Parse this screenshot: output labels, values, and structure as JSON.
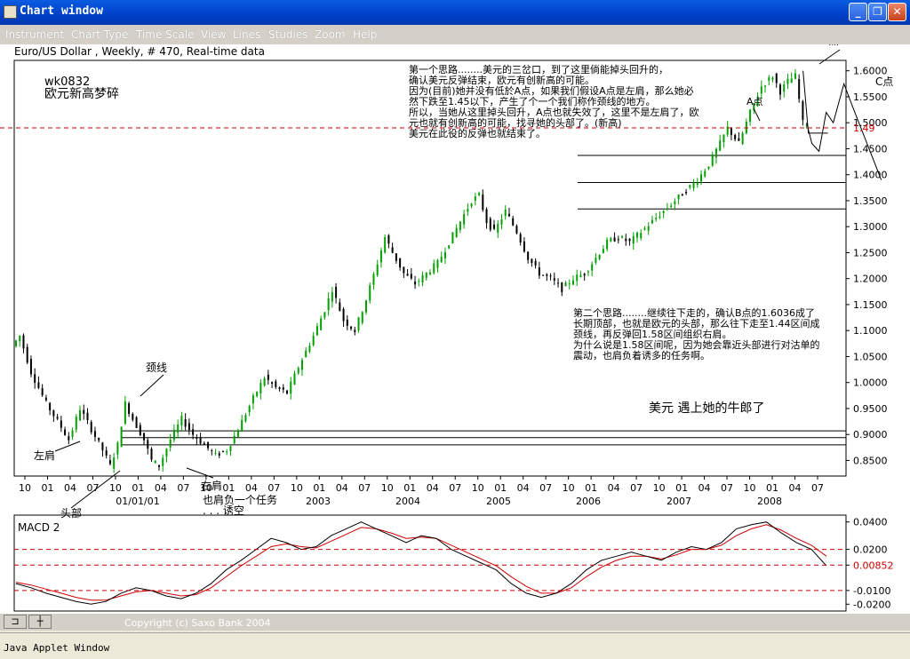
{
  "window": {
    "title": "Chart window",
    "buttons": [
      "_",
      "❐",
      "✕"
    ]
  },
  "menu": [
    "Instrument",
    "Chart Type",
    "Time Scale",
    "View",
    "Lines",
    "Studies",
    "Zoom",
    "Help"
  ],
  "chart_header": "Euro/US Dollar , Weekly, # 470, Real-time data",
  "colors": {
    "up": "#00a000",
    "down": "#000000",
    "dashed": "#cc0000",
    "macd": "#000000",
    "signal": "#cc0000"
  },
  "chart_data": [
    {
      "type": "candlestick",
      "title": "wk0832",
      "subtitle": "欧元新高梦碎",
      "ylim": [
        0.82,
        1.62
      ],
      "y_ticks": [
        "1.6000",
        "1.5500",
        "1.5000",
        "1.4500",
        "1.4000",
        "1.3500",
        "1.3000",
        "1.2500",
        "1.2000",
        "1.1500",
        "1.1000",
        "1.0500",
        "1.0000",
        "0.9500",
        "0.9000",
        "0.8500"
      ],
      "y_tick_values": [
        1.6,
        1.55,
        1.5,
        1.45,
        1.4,
        1.35,
        1.3,
        1.25,
        1.2,
        1.15,
        1.1,
        1.05,
        1.0,
        0.95,
        0.9,
        0.85
      ],
      "x_ticks": [
        "10",
        "01",
        "04",
        "07",
        "10",
        "01",
        "04",
        "07",
        "10",
        "01",
        "04",
        "07",
        "10",
        "01",
        "04",
        "07",
        "10",
        "01",
        "04",
        "07",
        "10",
        "01",
        "04",
        "07",
        "10",
        "01",
        "04",
        "07",
        "10",
        "01",
        "04",
        "07",
        "10",
        "01",
        "04",
        "07"
      ],
      "x_year_labels": [
        "01/01/01",
        "2003",
        "2004",
        "2005",
        "2006",
        "2007",
        "2008"
      ],
      "current_price_label": "1.49",
      "current_price": 1.49,
      "trend_points": [
        [
          0,
          1.07
        ],
        [
          4,
          1.09
        ],
        [
          10,
          1.02
        ],
        [
          18,
          0.96
        ],
        [
          25,
          0.92
        ],
        [
          30,
          0.89
        ],
        [
          36,
          0.95
        ],
        [
          42,
          0.91
        ],
        [
          48,
          0.87
        ],
        [
          52,
          0.84
        ],
        [
          56,
          0.88
        ],
        [
          60,
          0.96
        ],
        [
          64,
          0.93
        ],
        [
          70,
          0.89
        ],
        [
          74,
          0.85
        ],
        [
          78,
          0.84
        ],
        [
          84,
          0.89
        ],
        [
          90,
          0.93
        ],
        [
          96,
          0.9
        ],
        [
          102,
          0.88
        ],
        [
          108,
          0.86
        ],
        [
          114,
          0.87
        ],
        [
          120,
          0.91
        ],
        [
          128,
          0.97
        ],
        [
          134,
          1.01
        ],
        [
          140,
          0.99
        ],
        [
          146,
          0.98
        ],
        [
          152,
          1.03
        ],
        [
          160,
          1.09
        ],
        [
          166,
          1.14
        ],
        [
          170,
          1.18
        ],
        [
          176,
          1.12
        ],
        [
          182,
          1.1
        ],
        [
          188,
          1.16
        ],
        [
          194,
          1.23
        ],
        [
          198,
          1.28
        ],
        [
          202,
          1.25
        ],
        [
          208,
          1.21
        ],
        [
          214,
          1.19
        ],
        [
          220,
          1.21
        ],
        [
          226,
          1.23
        ],
        [
          232,
          1.27
        ],
        [
          238,
          1.31
        ],
        [
          244,
          1.35
        ],
        [
          248,
          1.36
        ],
        [
          252,
          1.31
        ],
        [
          256,
          1.29
        ],
        [
          262,
          1.33
        ],
        [
          268,
          1.29
        ],
        [
          274,
          1.24
        ],
        [
          280,
          1.21
        ],
        [
          286,
          1.2
        ],
        [
          292,
          1.18
        ],
        [
          298,
          1.2
        ],
        [
          304,
          1.21
        ],
        [
          310,
          1.24
        ],
        [
          316,
          1.27
        ],
        [
          322,
          1.28
        ],
        [
          328,
          1.27
        ],
        [
          334,
          1.29
        ],
        [
          340,
          1.31
        ],
        [
          346,
          1.33
        ],
        [
          352,
          1.35
        ],
        [
          358,
          1.37
        ],
        [
          364,
          1.39
        ],
        [
          370,
          1.42
        ],
        [
          376,
          1.46
        ],
        [
          380,
          1.49
        ],
        [
          386,
          1.46
        ],
        [
          392,
          1.52
        ],
        [
          398,
          1.57
        ],
        [
          404,
          1.59
        ],
        [
          408,
          1.56
        ],
        [
          412,
          1.58
        ],
        [
          416,
          1.59
        ],
        [
          420,
          1.5
        ]
      ],
      "horizontal_lines": [
        1.437,
        1.385,
        1.334,
        0.907,
        0.894,
        0.88
      ],
      "annotations": [
        {
          "text": "第一个思路........美元的三岔口，到了这里倘能掉头回升的，"
        },
        {
          "text": "确认美元反弹结束，欧元有创新高的可能。"
        },
        {
          "text": "因为(目前)她并没有低於A点，如果我们假设A点是左肩，那么她必"
        },
        {
          "text": "然下跌至1.45以下，产生了个一个我们称作颈线的地方。"
        },
        {
          "text": "所以，当她从这里掉头回升，A点也就失效了，这里不是左肩了，欧"
        },
        {
          "text": "元也就有创新高的可能，找寻她的头部了。(新高)"
        },
        {
          "text": "美元在此役的反弹也就结束了。"
        }
      ],
      "annotations2": [
        {
          "text": "第二个思路........继续往下走的，确认B点的1.6036成了"
        },
        {
          "text": "长期顶部，也就是欧元的头部，那么往下走至1.44区间成"
        },
        {
          "text": "颈线，再反弹回1.58区间组织右肩。"
        },
        {
          "text": "为什么说是1.58区间呢，因为她会靠近头部进行对沽单的"
        },
        {
          "text": "震动，也肩负着诱多的任务啊。"
        }
      ],
      "labels": {
        "usd": "美元    遇上她的牛郎了",
        "a_point": "A点",
        "b_point": "B点",
        "c_point": "C点",
        "left_shoulder": "左肩",
        "head": "头部",
        "neckline": "颈线",
        "right_shoulder": "右肩",
        "right_shoulder_note": "也肩负一个任务",
        "bait": ". . . 诱空"
      }
    },
    {
      "type": "line",
      "title": "MACD 2",
      "y_ticks": [
        "0.0400",
        "0.0200",
        "0.00852",
        "-0.0100",
        "-0.0200"
      ],
      "y_tick_values": [
        0.04,
        0.02,
        0.00852,
        -0.01,
        -0.02
      ],
      "ylim": [
        -0.025,
        0.045
      ],
      "macd": [
        -0.005,
        -0.008,
        -0.012,
        -0.015,
        -0.018,
        -0.02,
        -0.018,
        -0.012,
        -0.008,
        -0.01,
        -0.014,
        -0.016,
        -0.012,
        -0.005,
        0.005,
        0.012,
        0.02,
        0.028,
        0.025,
        0.02,
        0.022,
        0.03,
        0.035,
        0.04,
        0.035,
        0.03,
        0.025,
        0.03,
        0.028,
        0.02,
        0.015,
        0.01,
        0.005,
        -0.005,
        -0.012,
        -0.015,
        -0.012,
        -0.005,
        0.005,
        0.012,
        0.015,
        0.018,
        0.015,
        0.012,
        0.018,
        0.022,
        0.02,
        0.025,
        0.035,
        0.038,
        0.04,
        0.032,
        0.025,
        0.02,
        0.008
      ],
      "signal": [
        -0.004,
        -0.006,
        -0.009,
        -0.012,
        -0.015,
        -0.017,
        -0.017,
        -0.014,
        -0.011,
        -0.01,
        -0.012,
        -0.014,
        -0.013,
        -0.008,
        0.0,
        0.008,
        0.015,
        0.022,
        0.024,
        0.022,
        0.021,
        0.026,
        0.031,
        0.036,
        0.035,
        0.032,
        0.028,
        0.029,
        0.028,
        0.023,
        0.018,
        0.013,
        0.008,
        0.0,
        -0.007,
        -0.012,
        -0.012,
        -0.008,
        0.0,
        0.007,
        0.012,
        0.015,
        0.015,
        0.013,
        0.016,
        0.02,
        0.02,
        0.023,
        0.03,
        0.035,
        0.038,
        0.034,
        0.028,
        0.023,
        0.015
      ]
    }
  ],
  "bottom": {
    "copyright": "Copyright (c) Saxo Bank 2004",
    "tool1": "⊐",
    "tool2": "┼"
  },
  "status": "Java Applet Window"
}
